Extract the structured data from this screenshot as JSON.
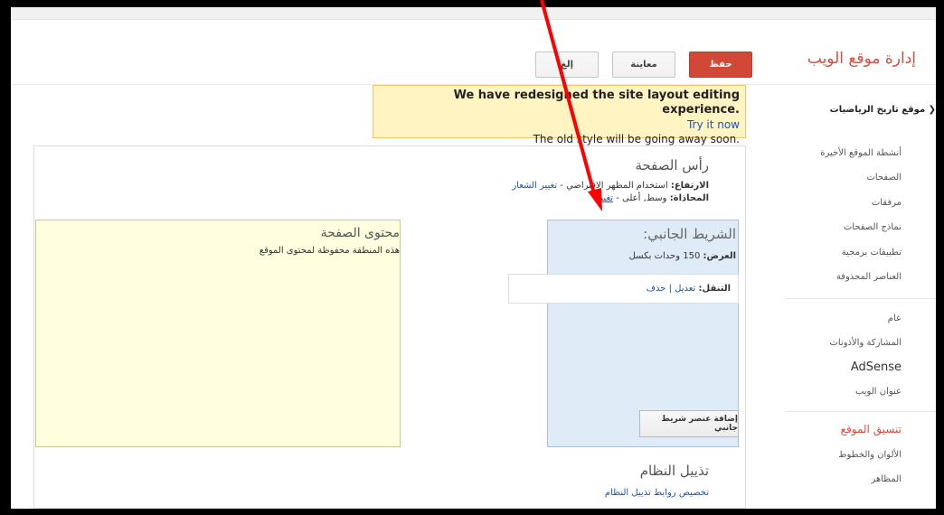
{
  "header": {
    "title": "إدارة موقع الويب",
    "save_label": "حفظ",
    "preview_label": "معاينة",
    "cancel_label": "إلغ"
  },
  "sidebar": {
    "site_name": "❮ موقع تاريخ الرياضيات",
    "group1": [
      "أنشطة الموقع الأخيرة",
      "الصفحات",
      "مرفقات",
      "نماذج الصفحات",
      "تطبيقات برمجية",
      "العناصر المحذوفة"
    ],
    "group2": [
      "عام",
      "المشاركة والأذونات",
      "AdSense",
      "عنوان الويب"
    ],
    "group3": [
      "تنسيق الموقع",
      "الألوان والخطوط",
      "المظاهر"
    ]
  },
  "banner": {
    "line1": "We have redesigned the site layout editing experience.",
    "try_link": "Try it now",
    "line3": "The old style will be going away soon."
  },
  "layout": {
    "header_region": {
      "title": "رأس الصفحة",
      "height_label": "الارتفاع:",
      "height_value": "استخدام المظهر الافتراضي -",
      "change_logo": "تغيير الشعار",
      "align_label": "المحاذاة:",
      "align_value": "وسط, أعلى -",
      "change": "تغيير"
    },
    "page_content": {
      "title": "محتوى الصفحة",
      "desc": "هذه المنطقة محفوظة لمحتوى الموقع"
    },
    "sidebar_region": {
      "title": "الشريط الجانبي:",
      "width_label": "العرض:",
      "width_value": "150 وحدات بكسل",
      "nav_label": "التنقل:",
      "edit": "تعديل",
      "pipe": "|",
      "delete": "حذف",
      "add_gadget": "إضافة عنصر شريط جانبي"
    },
    "footer_region": {
      "title": "تذييل النظام",
      "link": "تخصيص روابط تذييل النظام"
    }
  },
  "colors": {
    "accent": "#dd4b39",
    "link": "#1155cc",
    "annotation_arrow": "#ff0000"
  }
}
